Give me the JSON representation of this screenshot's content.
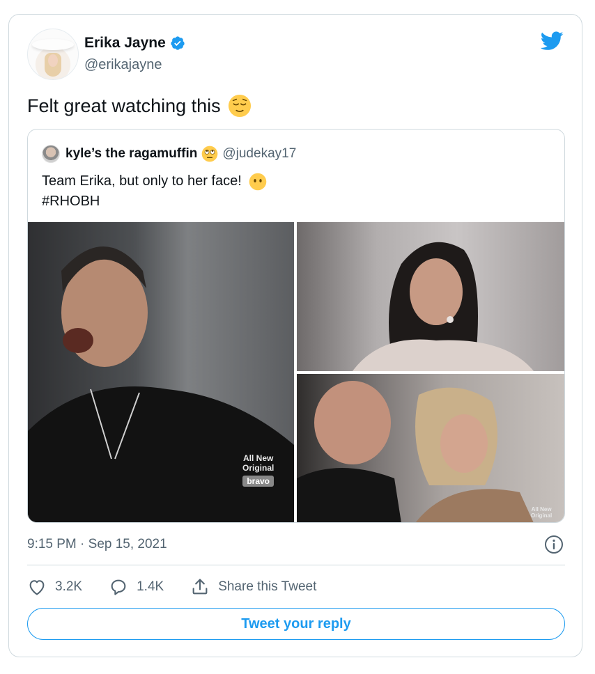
{
  "tweet": {
    "author": {
      "display_name": "Erika Jayne",
      "handle": "@erikajayne",
      "verified": true,
      "avatar_icon": "profile-photo"
    },
    "text": "Felt great watching this",
    "text_emoji": "relieved-face-emoji",
    "timestamp": "9:15 PM · Sep 15, 2021",
    "brand_icon": "twitter-bird-icon",
    "accent_color": "#1d9bf0"
  },
  "quoted": {
    "display_name": "kyle’s the ragamuffin",
    "name_emoji": "face-with-rolling-eyes-emoji",
    "handle": "@judekay17",
    "text_line1": "Team Erika, but only to her face!",
    "text_line1_emoji": "face-without-mouth-emoji",
    "text_line2": "#RHOBH",
    "media": [
      {
        "alt": "man laughing",
        "watermark_line1": "All New",
        "watermark_line2": "Original",
        "watermark_brand": "bravo"
      },
      {
        "alt": "woman with ponytail"
      },
      {
        "alt": "man and blonde woman at dinner",
        "watermark_line1": "All New",
        "watermark_line2": "Original"
      }
    ]
  },
  "actions": {
    "like_count": "3.2K",
    "reply_count": "1.4K",
    "share_label": "Share this Tweet"
  },
  "reply_button_label": "Tweet your reply"
}
